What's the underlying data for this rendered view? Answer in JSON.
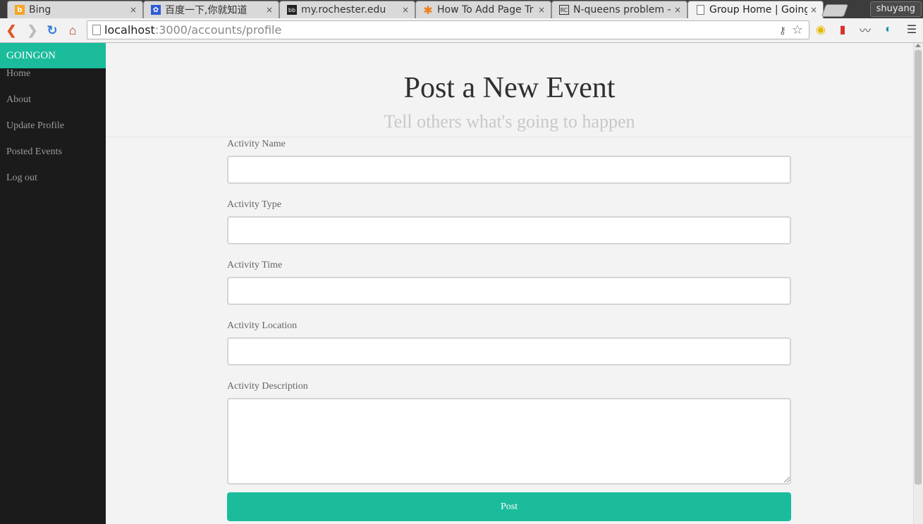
{
  "browser": {
    "tabs": [
      {
        "title": "Bing",
        "favicon": "bing-icon"
      },
      {
        "title": "百度一下,你就知道",
        "favicon": "baidu-paw-icon"
      },
      {
        "title": "my.rochester.edu",
        "favicon": "rochester-icon"
      },
      {
        "title": "How To Add Page Tr",
        "favicon": "asterisk-icon"
      },
      {
        "title": "N-queens problem -",
        "favicon": "rosetta-code-icon"
      },
      {
        "title": "Group Home | Going",
        "favicon": "page-icon"
      }
    ],
    "close_glyph": "×",
    "user": "shuyang",
    "url_host": "localhost",
    "url_rest": ":3000/accounts/profile"
  },
  "sidebar": {
    "brand": "GOINGON",
    "items": [
      "Home",
      "About",
      "Update Profile",
      "Posted Events",
      "Log out"
    ]
  },
  "page": {
    "title": "Post a New Event",
    "subtitle": "Tell others what's going to happen"
  },
  "form": {
    "fields": [
      {
        "label": "Activity Name",
        "value": ""
      },
      {
        "label": "Activity Type",
        "value": ""
      },
      {
        "label": "Activity Time",
        "value": ""
      },
      {
        "label": "Activity Location",
        "value": ""
      },
      {
        "label": "Activity Description",
        "value": ""
      }
    ],
    "submit_label": "Post"
  },
  "colors": {
    "accent": "#1abc9c",
    "sidebar_bg": "#1b1b1b",
    "page_bg": "#f3f3f3"
  }
}
